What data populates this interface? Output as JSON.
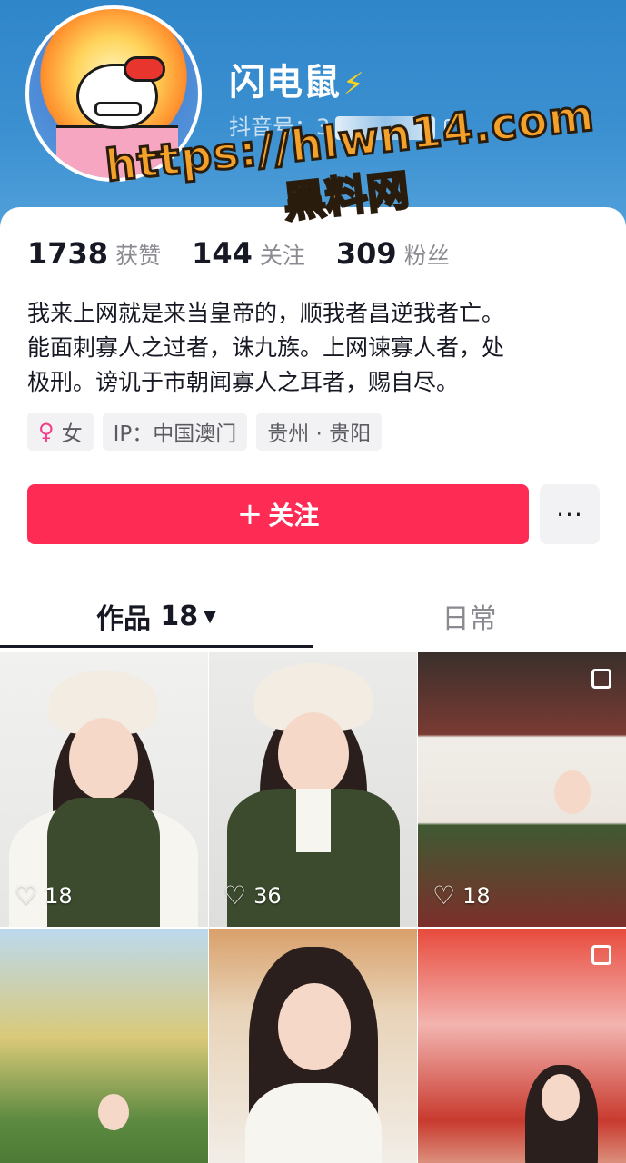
{
  "profile": {
    "username": "闪电鼠",
    "username_badge": "⚡",
    "douyin_id_label": "抖音号：3",
    "avatar": "hello-kitty-avatar"
  },
  "watermark": {
    "url": "https://hlwn14.com",
    "name": "黑料网"
  },
  "stats": [
    {
      "value": "1738",
      "label": "获赞"
    },
    {
      "value": "144",
      "label": "关注"
    },
    {
      "value": "309",
      "label": "粉丝"
    }
  ],
  "bio": [
    "我来上网就是来当皇帝的，顺我者昌逆我者亡。",
    "能面刺寡人之过者，诛九族。上网谏寡人者，处",
    "极刑。谤讥于市朝闻寡人之耳者，赐自尽。"
  ],
  "tags": {
    "gender": "女",
    "ip": "IP：中国澳门",
    "location": "贵州 · 贵阳"
  },
  "actions": {
    "follow_label": "关注",
    "more_label": "···"
  },
  "tabs": {
    "works_label": "作品",
    "works_count": "18",
    "daily_label": "日常"
  },
  "videos": [
    {
      "likes": "18"
    },
    {
      "likes": "36"
    },
    {
      "likes": "18"
    },
    {
      "likes": ""
    },
    {
      "likes": ""
    },
    {
      "likes": ""
    }
  ],
  "colors": {
    "header_blue": "#2f86c9",
    "follow_red": "#fe2c55",
    "watermark_orange": "#f3a12a"
  }
}
